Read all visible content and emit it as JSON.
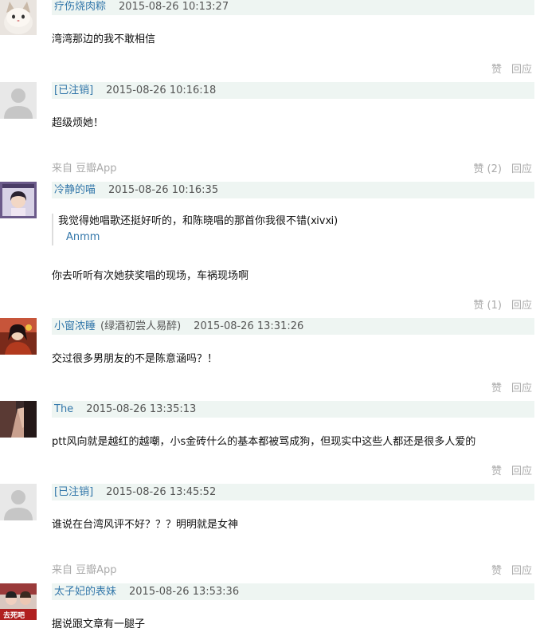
{
  "comments": [
    {
      "author": "疗伤烧肉粽",
      "time": "2015-08-26 10:13:27",
      "text": "湾湾那边的我不敢相信",
      "like": "赞",
      "reply": "回应"
    },
    {
      "author": "[已注销]",
      "time": "2015-08-26 10:16:18",
      "text": "超级烦她！",
      "source": "来自 豆瓣App",
      "like": "赞 (2)",
      "reply": "回应"
    },
    {
      "author": "冷静的喵",
      "time": "2015-08-26 10:16:35",
      "quote_text": "我觉得她唱歌还挺好听的，和陈晓唱的那首你我很不错(ⅺⅴⅺ)",
      "quote_author": "Anmm",
      "text": "你去听听有次她获奖唱的现场，车祸现场啊",
      "like": "赞 (1)",
      "reply": "回应"
    },
    {
      "author": "小窗浓睡",
      "signature": "(绿酒初尝人易醉)",
      "time": "2015-08-26 13:31:26",
      "text": "交过很多男朋友的不是陈意涵吗？！",
      "like": "赞",
      "reply": "回应"
    },
    {
      "author": "The",
      "time": "2015-08-26 13:35:13",
      "text": "ptt风向就是越红的越嘲，小s金砖什么的基本都被骂成狗，但现实中这些人都还是很多人爱的",
      "like": "赞",
      "reply": "回应"
    },
    {
      "author": "[已注销]",
      "time": "2015-08-26 13:45:52",
      "text": "谁说在台湾风评不好？？？明明就是女神",
      "source": "来自 豆瓣App",
      "like": "赞",
      "reply": "回应"
    },
    {
      "author": "太子妃的表妹",
      "time": "2015-08-26 13:53:36",
      "text": "据说跟文章有一腿子",
      "avatar_caption": "去死吧"
    }
  ]
}
